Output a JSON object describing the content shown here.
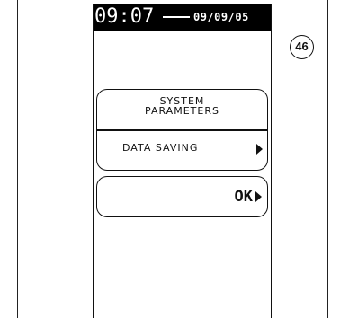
{
  "status_bar": {
    "time": "09:07",
    "date": "09/09/05"
  },
  "menu": {
    "header_line1": "SYSTEM",
    "header_line2": "PARAMETERS",
    "item_label": "DATA SAVING",
    "item_arrow_icon": "right-triangle-icon"
  },
  "ok_button": {
    "label": "OK",
    "arrow_icon": "right-triangle-icon"
  },
  "reference_badge": {
    "number": "46"
  },
  "colors": {
    "status_bar_bg": "#000000",
    "status_bar_text": "#ffffff",
    "outline": "#111111"
  }
}
